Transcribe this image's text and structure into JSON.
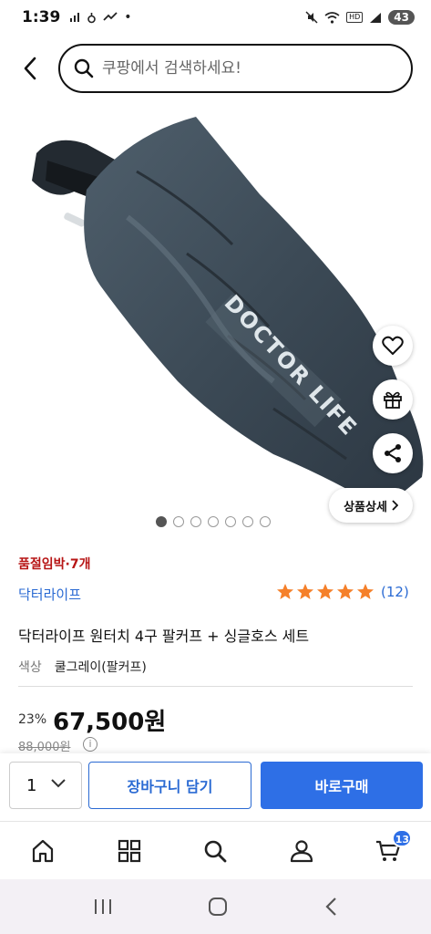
{
  "status_bar": {
    "time": "1:39",
    "hd_label": "HD",
    "battery": "43"
  },
  "search": {
    "placeholder": "쿠팡에서 검색하세요!"
  },
  "gallery": {
    "image_count": 7,
    "active_index": 0,
    "detail_button_label": "상품상세",
    "product_print_text": "DOCTOR LIFE"
  },
  "product": {
    "stock_badge": "품절임박·7개",
    "brand": "닥터라이프",
    "rating": 5,
    "review_count": "(12)",
    "title": "닥터라이프 원터치 4구 팔커프 + 싱글호스 세트",
    "option_label": "색상",
    "option_value": "쿨그레이(팔커프)",
    "discount": "23%",
    "price": "67,500원",
    "original_price": "88,000원"
  },
  "purchase": {
    "quantity": "1",
    "cart_button": "장바구니 담기",
    "buy_button": "바로구매"
  },
  "bottom_nav": {
    "items": [
      "home-icon",
      "category-icon",
      "search-icon",
      "user-icon",
      "cart-icon"
    ],
    "cart_badge": "13"
  },
  "colors": {
    "accent": "#2e6fe6",
    "link": "#2a6ad3",
    "stock_red": "#b71515",
    "star": "#f5802a"
  }
}
